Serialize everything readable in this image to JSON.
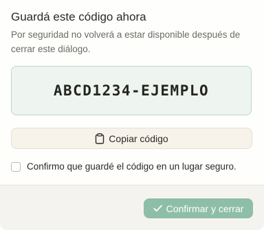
{
  "dialog": {
    "title": "Guardá este código ahora",
    "description": "Por seguridad no volverá a estar disponible después de cerrar este diálogo.",
    "code": "ABCD1234-EJEMPLO",
    "copy_button": {
      "label": "Copiar código",
      "icon": "clipboard-icon"
    },
    "confirm_checkbox": {
      "label": "Confirmo que guardé el código en un lugar seguro.",
      "checked": false
    },
    "primary_button": {
      "label": "Confirmar y cerrar",
      "icon": "check-icon",
      "enabled": false
    }
  },
  "colors": {
    "code_box_bg": "#eef5f1",
    "code_box_border": "#b9d6ca",
    "copy_button_bg": "#f7f3ea",
    "footer_bg": "#f5f3ef",
    "primary_button_bg": "#8ebea7"
  }
}
